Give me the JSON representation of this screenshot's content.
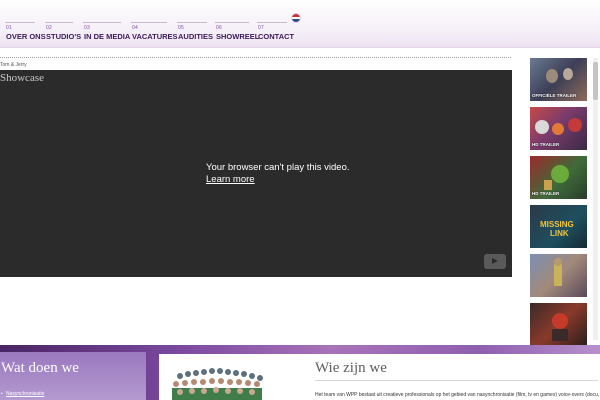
{
  "nav": {
    "items": [
      {
        "num": "01",
        "label": "OVER ONS"
      },
      {
        "num": "02",
        "label": "STUDIO'S"
      },
      {
        "num": "03",
        "label": "IN DE MEDIA"
      },
      {
        "num": "04",
        "label": "VACATURES"
      },
      {
        "num": "05",
        "label": "AUDITIES"
      },
      {
        "num": "06",
        "label": "SHOWREEL"
      },
      {
        "num": "07",
        "label": "CONTACT"
      }
    ],
    "language_icon": "dutch-flag-icon"
  },
  "video": {
    "caption": "Tom & Jerry",
    "title": "Showcase",
    "message": "Your browser can't play this video.",
    "learn_more": "Learn more",
    "play_icon": "youtube-logo-icon"
  },
  "thumbnails": [
    {
      "label": "OFFICIËLE TRAILER"
    },
    {
      "label": "HD TRAILER"
    },
    {
      "label": "HD TRAILER"
    },
    {
      "label": ""
    },
    {
      "label": ""
    },
    {
      "label": ""
    }
  ],
  "what": {
    "title": "Wat doen we",
    "link": "Nasynchronisatie"
  },
  "who": {
    "title": "Wie zijn we",
    "text": "Het team van WPP bestaat uit creatieve professionals op het gebied van nasynchronisatie (film, tv en games) voice-overs (docu,"
  }
}
